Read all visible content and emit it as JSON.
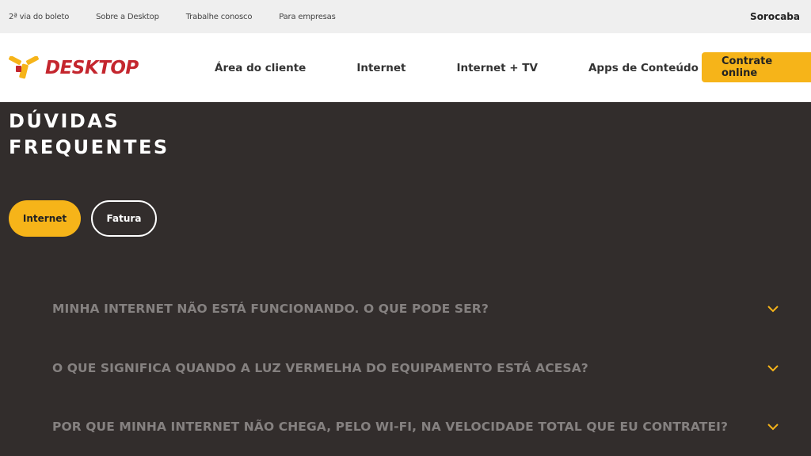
{
  "topbar": {
    "links": [
      "2ª via do boleto",
      "Sobre a Desktop",
      "Trabalhe conosco",
      "Para empresas"
    ],
    "city": "Sorocaba"
  },
  "header": {
    "brand": "DESKTOP",
    "nav": [
      "Área do cliente",
      "Internet",
      "Internet + TV",
      "Apps de Conteúdo"
    ],
    "cta": "Contrate online"
  },
  "main": {
    "title_line1": "DÚVIDAS",
    "title_line2": "FREQUENTES",
    "tabs": [
      {
        "label": "Internet",
        "active": true
      },
      {
        "label": "Fatura",
        "active": false
      }
    ],
    "faqs": [
      "MINHA INTERNET NÃO ESTÁ FUNCIONANDO. O QUE PODE SER?",
      "O QUE SIGNIFICA QUANDO A LUZ VERMELHA DO EQUIPAMENTO ESTÁ ACESA?",
      "POR QUE MINHA INTERNET NÃO CHEGA, PELO WI-FI, NA VELOCIDADE TOTAL QUE EU CONTRATEI?"
    ]
  },
  "colors": {
    "accent": "#f6b419",
    "brand_red": "#c4262e",
    "background_dark": "#322d2c",
    "faq_text": "#858180"
  },
  "icons": {
    "logo": "desktop-logo-icon",
    "faq_toggle": "chevron-down-icon"
  }
}
